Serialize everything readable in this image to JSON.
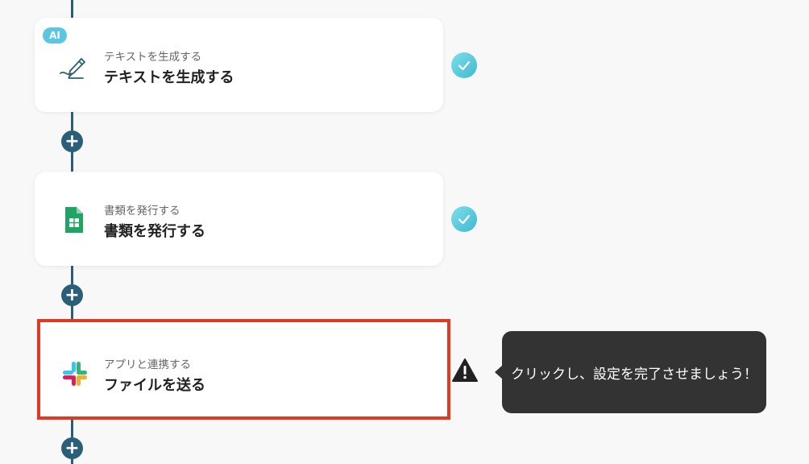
{
  "steps": [
    {
      "badge": "AI",
      "icon": "pencil-icon",
      "subtitle": "テキストを生成する",
      "title": "テキストを生成する",
      "status": "completed"
    },
    {
      "icon": "google-sheets-icon",
      "subtitle": "書類を発行する",
      "title": "書類を発行する",
      "status": "completed"
    },
    {
      "icon": "slack-icon",
      "subtitle": "アプリと連携する",
      "title": "ファイルを送る",
      "status": "incomplete"
    }
  ],
  "add_step_label": "+",
  "tooltip": {
    "text": "クリックし、設定を完了させましょう！"
  },
  "colors": {
    "connector": "#2b5f78",
    "highlight_border": "#e03a23",
    "check": "#4fc1d8",
    "tooltip_bg": "#333333"
  }
}
